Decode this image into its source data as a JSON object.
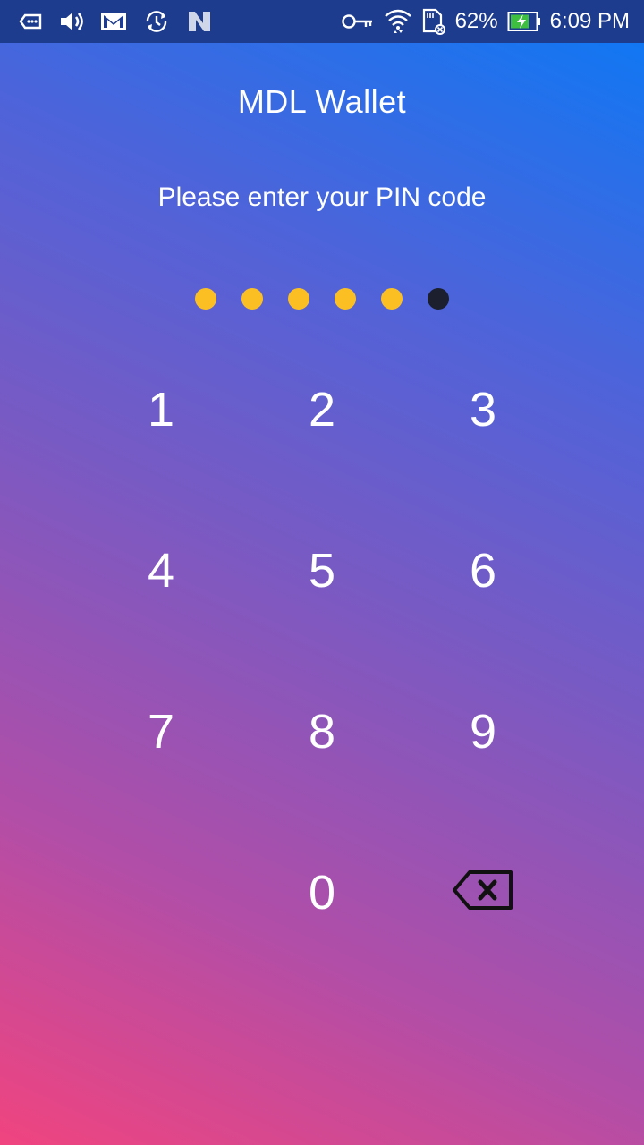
{
  "status_bar": {
    "battery_percent": "62%",
    "time": "6:09 PM",
    "icons": [
      "keyboard-icon",
      "volume-icon",
      "gmail-icon",
      "sync-icon",
      "n-icon",
      "vpn-key-icon",
      "wifi-icon",
      "sim-card-icon",
      "battery-charging-icon"
    ]
  },
  "app": {
    "title": "MDL Wallet",
    "prompt": "Please enter your PIN code"
  },
  "pin": {
    "length": 6,
    "entered": 5,
    "filled_color": "#fbbf24",
    "empty_color": "#1b1f2e"
  },
  "keypad": {
    "k1": "1",
    "k2": "2",
    "k3": "3",
    "k4": "4",
    "k5": "5",
    "k6": "6",
    "k7": "7",
    "k8": "8",
    "k9": "9",
    "k0": "0",
    "backspace_icon": "backspace-icon"
  },
  "colors": {
    "status_bar_bg": "#1d3c8e",
    "gradient_top": "#0a79f6",
    "gradient_bottom": "#f0447f"
  }
}
